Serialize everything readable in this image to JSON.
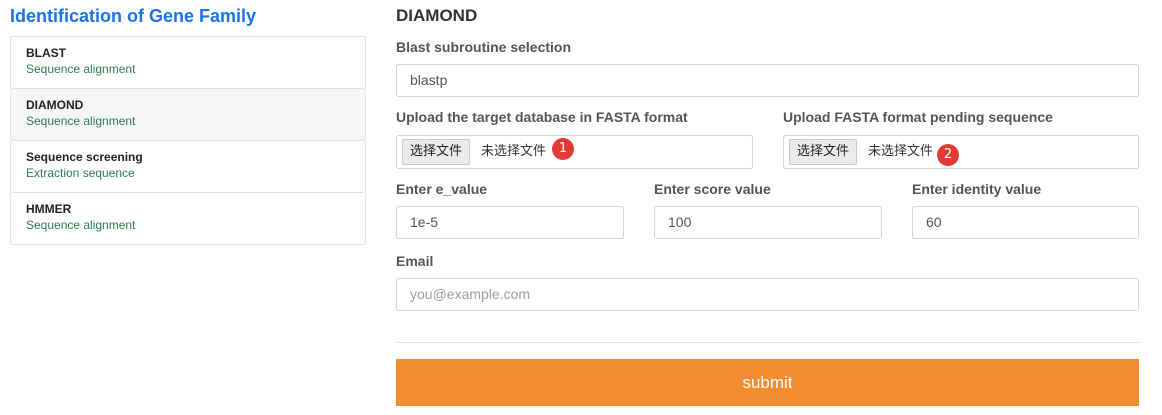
{
  "sidebar": {
    "title": "Identification of Gene Family",
    "items": [
      {
        "title": "BLAST",
        "subtitle": "Sequence alignment"
      },
      {
        "title": "DIAMOND",
        "subtitle": "Sequence alignment"
      },
      {
        "title": "Sequence screening",
        "subtitle": "Extraction sequence"
      },
      {
        "title": "HMMER",
        "subtitle": "Sequence alignment"
      }
    ]
  },
  "main": {
    "title": "DIAMOND",
    "subroutine": {
      "label": "Blast subroutine selection",
      "value": "blastp"
    },
    "target_db": {
      "label": "Upload the target database in FASTA format",
      "button": "选择文件",
      "status": "未选择文件",
      "badge": "1"
    },
    "pending_seq": {
      "label": "Upload FASTA format pending sequence",
      "button": "选择文件",
      "status": "未选择文件",
      "badge": "2"
    },
    "e_value": {
      "label": "Enter e_value",
      "value": "1e-5"
    },
    "score": {
      "label": "Enter score value",
      "value": "100"
    },
    "identity": {
      "label": "Enter identity value",
      "value": "60"
    },
    "email": {
      "label": "Email",
      "placeholder": "you@example.com"
    },
    "submit_label": "submit"
  },
  "colors": {
    "accent_blue": "#1a73e8",
    "submit_orange": "#f38b30",
    "badge_red": "#e53935",
    "subtitle_green": "#2e7d4f"
  }
}
